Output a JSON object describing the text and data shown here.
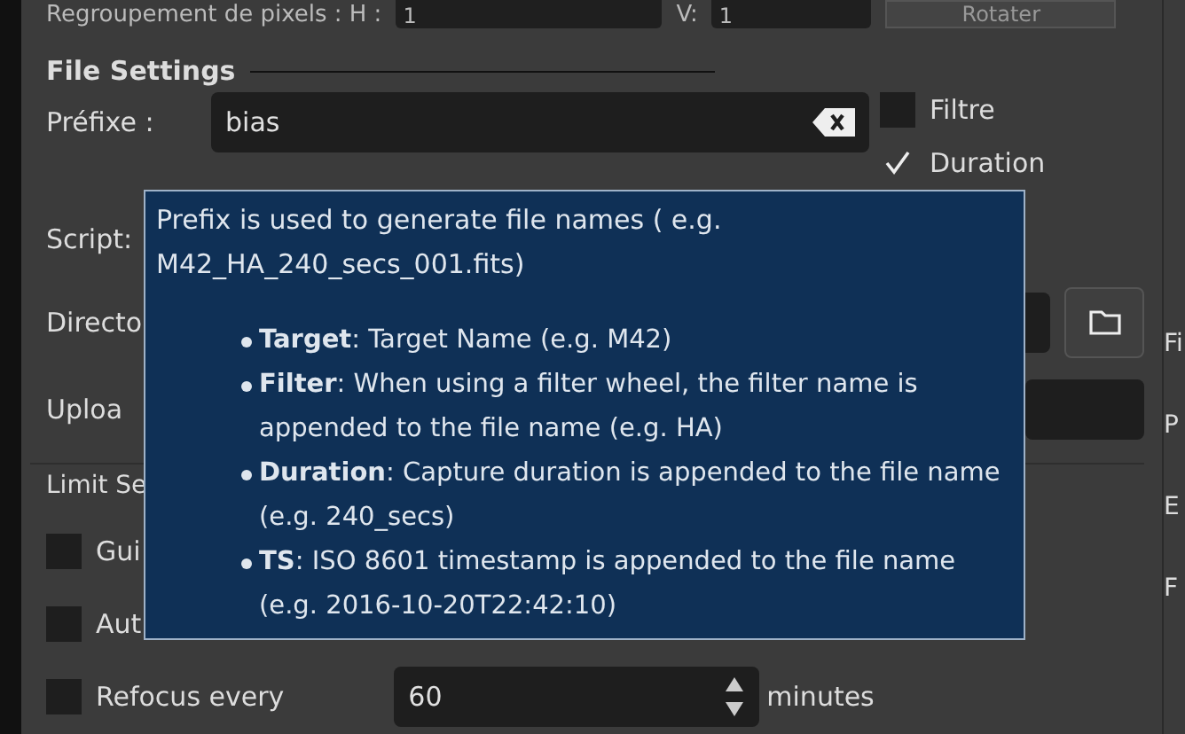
{
  "binning_row": {
    "label": "Regroupement de pixels : H :",
    "h_value": "1",
    "v_label": "V:",
    "v_value": "1",
    "button": "Rotater"
  },
  "file_settings": {
    "title": "File Settings",
    "prefix": {
      "label": "Préfixe :",
      "value": "bias"
    },
    "options": [
      {
        "label": "Filtre",
        "checked": false
      },
      {
        "label": "Duration",
        "checked": true
      }
    ],
    "script_label": "Script:",
    "directory_label": "Directo",
    "upload_label": "Uploa"
  },
  "limit_settings": {
    "title": "Limit Se",
    "items": [
      {
        "label": "Gui",
        "checked": false
      },
      {
        "label": "Aut",
        "checked": false
      },
      {
        "label": "Refocus every",
        "checked": false,
        "value": "60",
        "unit": "minutes"
      }
    ]
  },
  "right_panel": [
    "Fi",
    "P",
    "E",
    "F"
  ],
  "tooltip": {
    "intro": "Prefix is used to generate file names ( e.g. M42_HA_240_secs_001.fits)",
    "bullets": [
      "**Target**: Target Name (e.g. M42)",
      "**Filter**: When using a filter wheel, the filter name is appended to the file name (e.g. HA)",
      "**Duration**: Capture duration is appended to the file name (e.g. 240_secs)",
      "**TS**: ISO 8601 timestamp is appended to the file name (e.g. 2016-10-20T22:42:10)"
    ]
  }
}
